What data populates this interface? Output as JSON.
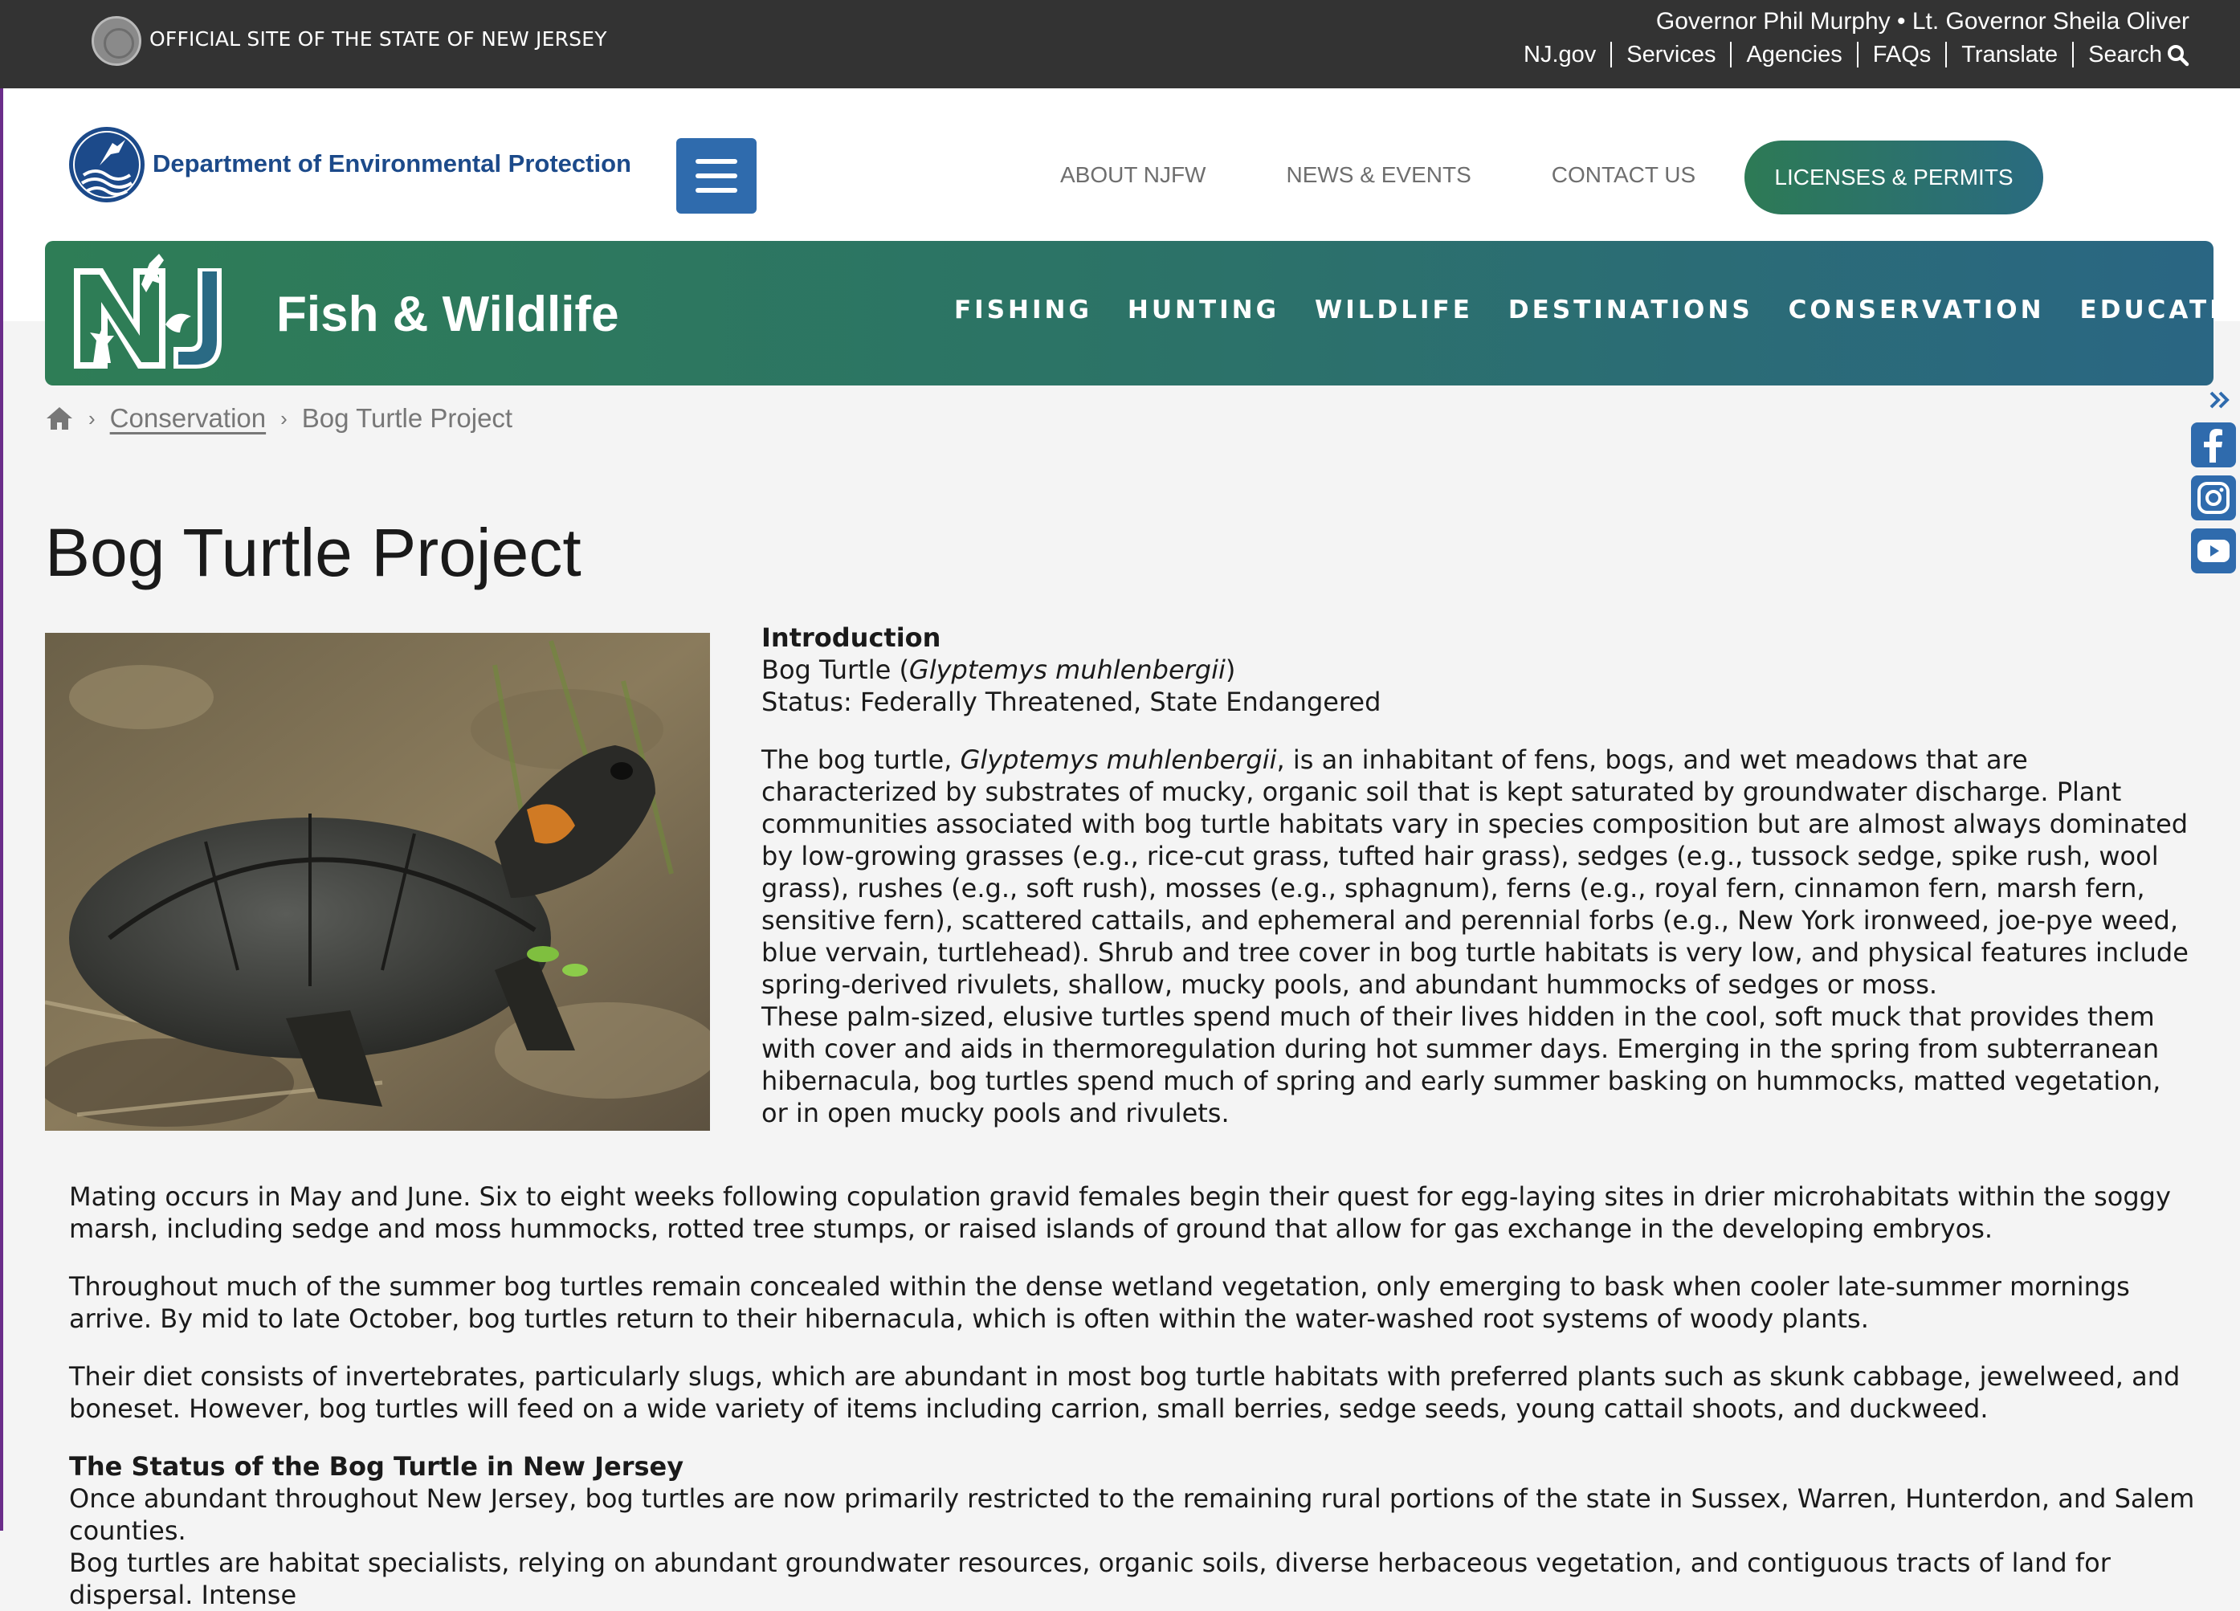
{
  "gov_bar": {
    "official_text": "OFFICIAL SITE OF THE STATE OF NEW JERSEY",
    "governor_line": "Governor Phil Murphy • Lt. Governor Sheila Oliver",
    "links": [
      "NJ.gov",
      "Services",
      "Agencies",
      "FAQs",
      "Translate",
      "Search"
    ]
  },
  "header": {
    "department_name": "Department of Environmental Protection",
    "nav": [
      "ABOUT NJFW",
      "NEWS & EVENTS",
      "CONTACT US"
    ],
    "licenses_button": "LICENSES & PERMITS"
  },
  "banner": {
    "title": "Fish & Wildlife",
    "nav": [
      "FISHING",
      "HUNTING",
      "WILDLIFE",
      "DESTINATIONS",
      "CONSERVATION",
      "EDUCATION"
    ]
  },
  "breadcrumb": {
    "items": [
      "Conservation",
      "Bog Turtle Project"
    ]
  },
  "social": [
    "facebook",
    "instagram",
    "youtube"
  ],
  "colors": {
    "gov_bar": "#333333",
    "banner_start": "#2e7d56",
    "banner_end": "#2a6683",
    "accent_blue": "#2f6bad",
    "dep_blue": "#1c4a8a"
  },
  "page": {
    "title": "Bog Turtle Project",
    "intro_heading": "Introduction",
    "species_prefix": "Bog Turtle (",
    "species_latin": "Glyptemys muhlenbergii",
    "species_suffix": ")",
    "status_line": "Status: Federally Threatened, State Endangered",
    "p1_prefix": "The bog turtle, ",
    "p1_latin": "Glyptemys muhlenbergii",
    "p1_rest": ", is an inhabitant of fens, bogs, and wet meadows that are characterized by substrates of mucky, organic soil that is kept saturated by groundwater discharge. Plant communities associated with bog turtle habitats vary in species composition but are almost always dominated by low-growing grasses (e.g., rice-cut grass, tufted hair grass), sedges (e.g., tussock sedge, spike rush, wool grass), rushes (e.g., soft rush), mosses (e.g., sphagnum), ferns (e.g., royal fern, cinnamon fern, marsh fern, sensitive fern), scattered cattails, and ephemeral and perennial forbs (e.g., New York ironweed, joe-pye weed, blue vervain, turtlehead). Shrub and tree cover in bog turtle habitats is very low, and physical features include spring-derived rivulets, shallow, mucky pools, and abundant hummocks of sedges or moss.",
    "p2": "These palm-sized, elusive turtles spend much of their lives hidden in the cool, soft muck that provides them with cover and aids in thermoregulation during hot summer days. Emerging in the spring from subterranean hibernacula, bog turtles spend much of spring and early summer basking on hummocks, matted vegetation, or in open mucky pools and rivulets.",
    "p3": "Mating occurs in May and June. Six to eight weeks following copulation gravid females begin their quest for egg-laying sites in drier microhabitats within the soggy marsh, including sedge and moss hummocks, rotted tree stumps, or raised islands of ground that allow for gas exchange in the developing embryos.",
    "p4": "Throughout much of the summer bog turtles remain concealed within the dense wetland vegetation, only emerging to bask when cooler late-summer mornings arrive. By mid to late October, bog turtles return to their hibernacula, which is often within the water-washed root systems of woody plants.",
    "p5": "Their diet consists of invertebrates, particularly slugs, which are abundant in most bog turtle habitats with preferred plants such as skunk cabbage, jewelweed, and boneset. However, bog turtles will feed on a wide variety of items including carrion, small berries, sedge seeds, young cattail shoots, and duckweed.",
    "status_heading": "The Status of the Bog Turtle in New Jersey",
    "p6": "Once abundant throughout New Jersey, bog turtles are now primarily restricted to the remaining rural portions of the state in Sussex, Warren, Hunterdon, and Salem counties.",
    "p7": "Bog turtles are habitat specialists, relying on abundant groundwater resources, organic soils, diverse herbaceous vegetation, and contiguous tracts of land for dispersal. Intense"
  }
}
